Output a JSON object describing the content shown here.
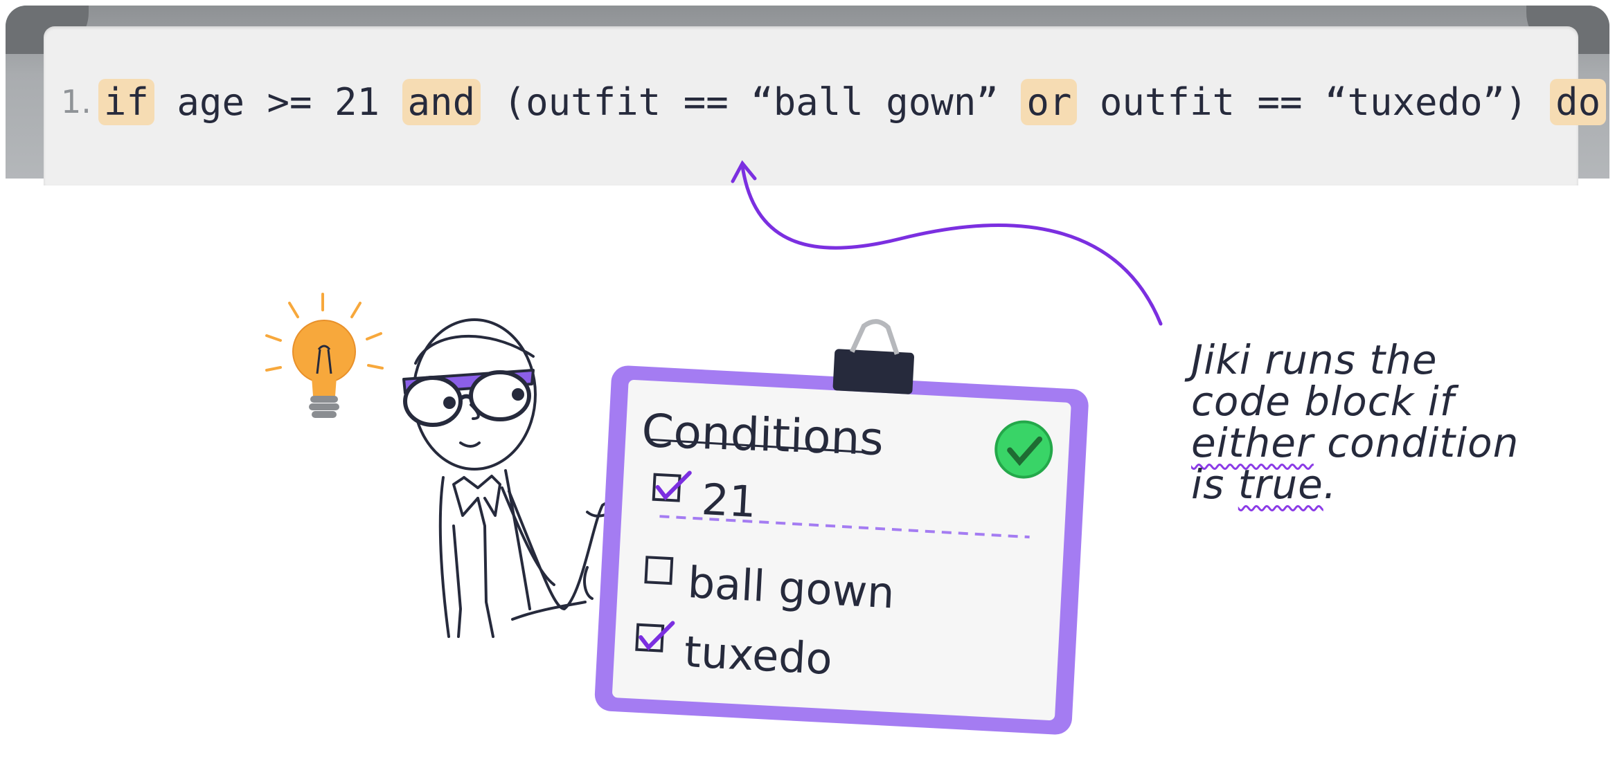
{
  "code": {
    "line_number": "1.",
    "tokens": [
      {
        "text": "if",
        "keyword": true
      },
      {
        "text": " age >= 21 ",
        "keyword": false
      },
      {
        "text": "and",
        "keyword": true
      },
      {
        "text": " (outfit == “ball gown” ",
        "keyword": false
      },
      {
        "text": "or",
        "keyword": true
      },
      {
        "text": " outfit == “tuxedo”) ",
        "keyword": false
      },
      {
        "text": "do",
        "keyword": true
      }
    ]
  },
  "clipboard": {
    "title": "Conditions",
    "all_met_icon": "green-check-icon",
    "items": [
      {
        "label": "21",
        "checked": true
      },
      {
        "label": "ball gown",
        "checked": false
      },
      {
        "label": "tuxedo",
        "checked": true
      }
    ]
  },
  "note": {
    "line1": "Jiki runs the",
    "line2": "code block if",
    "line3_emphasis": "either",
    "line3_rest": " condition",
    "line4_start": "is ",
    "line4_emphasis": "true",
    "line4_end": "."
  },
  "colors": {
    "accent_purple": "#8b3ce6",
    "clipboard_purple": "#a47cf2",
    "keyword_highlight": "#f6dcb3",
    "check_green": "#39d467",
    "bulb_orange": "#f7a83c"
  }
}
